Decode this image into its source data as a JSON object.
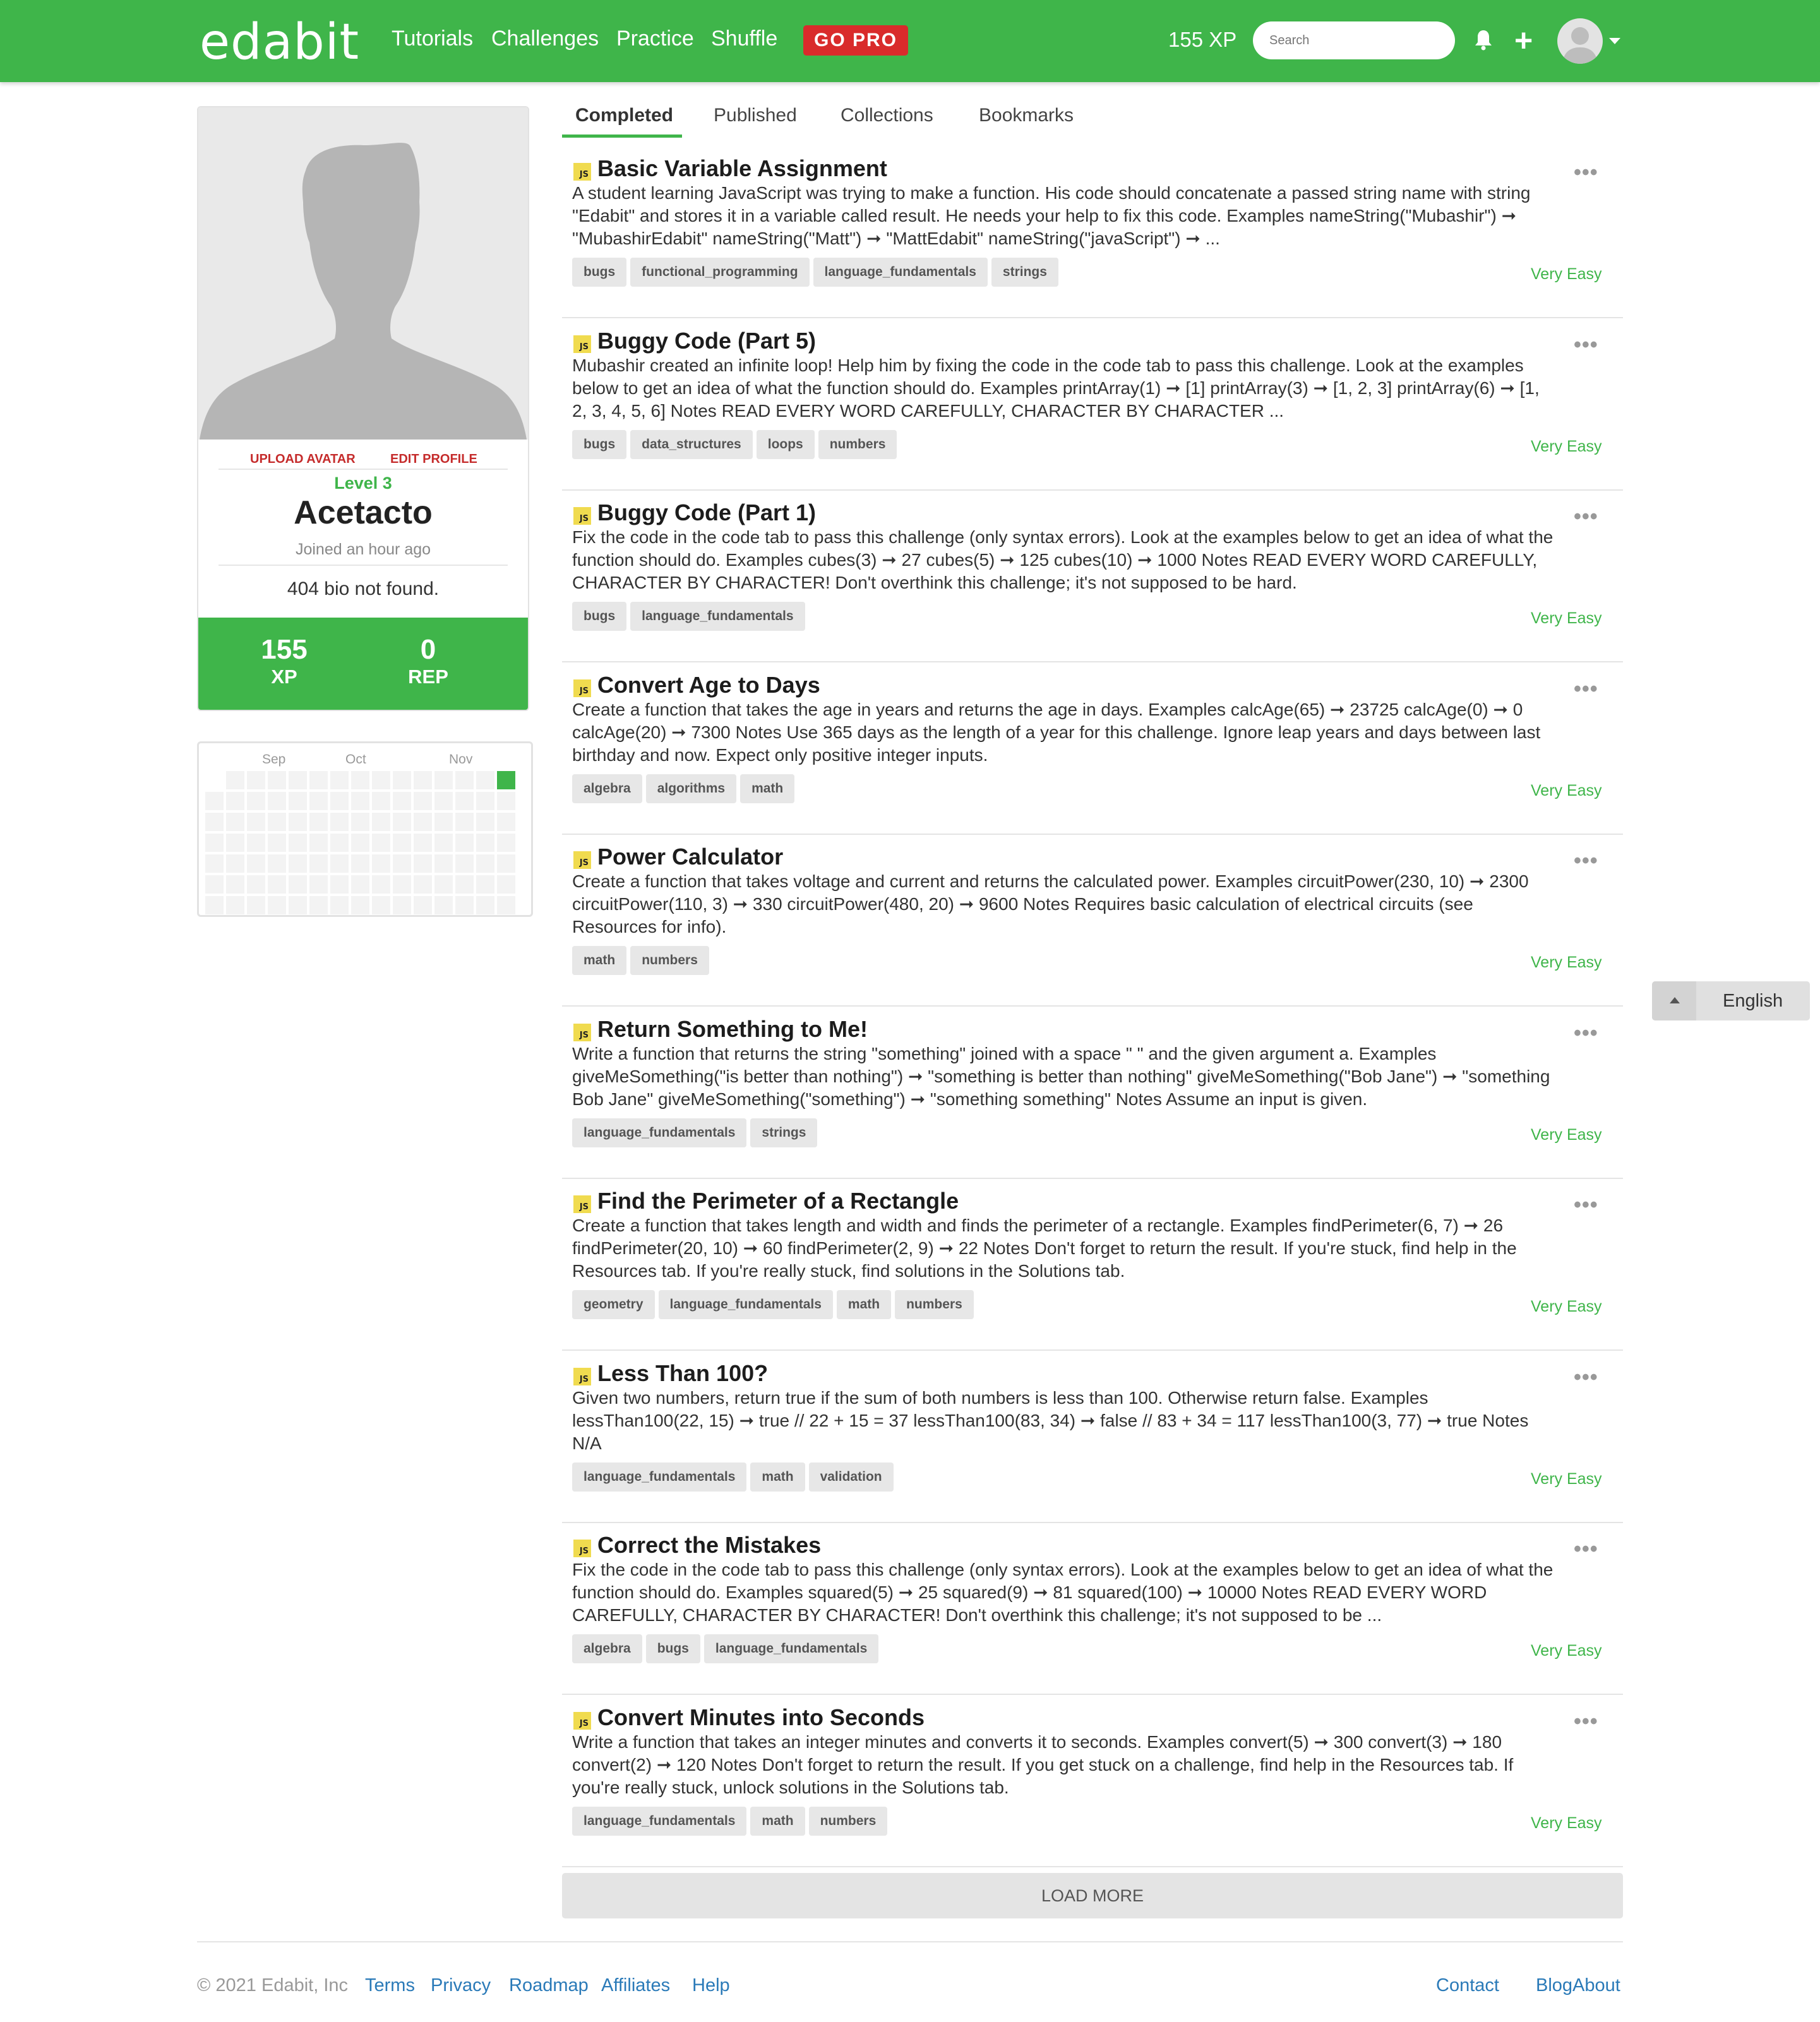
{
  "nav": {
    "logo": "edabit",
    "links": [
      "Tutorials",
      "Challenges",
      "Practice",
      "Shuffle"
    ],
    "go_pro": "GO PRO",
    "xp": "155 XP",
    "search_placeholder": "Search"
  },
  "profile": {
    "upload_avatar": "UPLOAD AVATAR",
    "edit_profile": "EDIT PROFILE",
    "level": "Level 3",
    "username": "Acetacto",
    "joined": "Joined an hour ago",
    "bio": "404 bio not found.",
    "xp_value": "155",
    "xp_label": "XP",
    "rep_value": "0",
    "rep_label": "REP"
  },
  "calendar": {
    "months": [
      "Sep",
      "Oct",
      "Nov"
    ],
    "active_color": "#3fb54a"
  },
  "tabs": [
    "Completed",
    "Published",
    "Collections",
    "Bookmarks"
  ],
  "challenges": [
    {
      "badge": "JS",
      "title": "Basic Variable Assignment",
      "description": "A student learning JavaScript was trying to make a function. His code should concatenate a passed string name with string \"Edabit\" and stores it in a variable called result. He needs your help to fix this code. Examples nameString(\"Mubashir\") ➞ \"MubashirEdabit\" nameString(\"Matt\") ➞ \"MattEdabit\" nameString(\"javaScript\") ➞ ...",
      "tags": [
        "bugs",
        "functional_programming",
        "language_fundamentals",
        "strings"
      ],
      "difficulty": "Very Easy"
    },
    {
      "badge": "JS",
      "title": "Buggy Code (Part 5)",
      "description": "Mubashir created an infinite loop! Help him by fixing the code in the code tab to pass this challenge. Look at the examples below to get an idea of what the function should do. Examples printArray(1) ➞ [1] printArray(3) ➞ [1, 2, 3] printArray(6) ➞ [1, 2, 3, 4, 5, 6] Notes READ EVERY WORD CAREFULLY, CHARACTER BY CHARACTER ...",
      "tags": [
        "bugs",
        "data_structures",
        "loops",
        "numbers"
      ],
      "difficulty": "Very Easy"
    },
    {
      "badge": "JS",
      "title": "Buggy Code (Part 1)",
      "description": "Fix the code in the code tab to pass this challenge (only syntax errors). Look at the examples below to get an idea of what the function should do. Examples cubes(3) ➞ 27 cubes(5) ➞ 125 cubes(10) ➞ 1000 Notes READ EVERY WORD CAREFULLY, CHARACTER BY CHARACTER! Don't overthink this challenge; it's not supposed to be hard.",
      "tags": [
        "bugs",
        "language_fundamentals"
      ],
      "difficulty": "Very Easy"
    },
    {
      "badge": "JS",
      "title": "Convert Age to Days",
      "description": "Create a function that takes the age in years and returns the age in days. Examples calcAge(65) ➞ 23725 calcAge(0) ➞ 0 calcAge(20) ➞ 7300 Notes Use 365 days as the length of a year for this challenge. Ignore leap years and days between last birthday and now. Expect only positive integer inputs.",
      "tags": [
        "algebra",
        "algorithms",
        "math"
      ],
      "difficulty": "Very Easy"
    },
    {
      "badge": "JS",
      "title": "Power Calculator",
      "description": "Create a function that takes voltage and current and returns the calculated power. Examples circuitPower(230, 10) ➞ 2300 circuitPower(110, 3) ➞ 330 circuitPower(480, 20) ➞ 9600 Notes Requires basic calculation of electrical circuits (see Resources for info).",
      "tags": [
        "math",
        "numbers"
      ],
      "difficulty": "Very Easy"
    },
    {
      "badge": "JS",
      "title": "Return Something to Me!",
      "description": "Write a function that returns the string \"something\" joined with a space \" \" and the given argument a. Examples giveMeSomething(\"is better than nothing\") ➞ \"something is better than nothing\" giveMeSomething(\"Bob Jane\") ➞ \"something Bob Jane\" giveMeSomething(\"something\") ➞ \"something something\" Notes Assume an input is given.",
      "tags": [
        "language_fundamentals",
        "strings"
      ],
      "difficulty": "Very Easy"
    },
    {
      "badge": "JS",
      "title": "Find the Perimeter of a Rectangle",
      "description": "Create a function that takes length and width and finds the perimeter of a rectangle. Examples findPerimeter(6, 7) ➞ 26 findPerimeter(20, 10) ➞ 60 findPerimeter(2, 9) ➞ 22 Notes Don't forget to return the result. If you're stuck, find help in the Resources tab. If you're really stuck, find solutions in the Solutions tab.",
      "tags": [
        "geometry",
        "language_fundamentals",
        "math",
        "numbers"
      ],
      "difficulty": "Very Easy"
    },
    {
      "badge": "JS",
      "title": "Less Than 100?",
      "description": "Given two numbers, return true if the sum of both numbers is less than 100. Otherwise return false. Examples lessThan100(22, 15) ➞ true // 22 + 15 = 37 lessThan100(83, 34) ➞ false // 83 + 34 = 117 lessThan100(3, 77) ➞ true Notes N/A",
      "tags": [
        "language_fundamentals",
        "math",
        "validation"
      ],
      "difficulty": "Very Easy"
    },
    {
      "badge": "JS",
      "title": "Correct the Mistakes",
      "description": "Fix the code in the code tab to pass this challenge (only syntax errors). Look at the examples below to get an idea of what the function should do. Examples squared(5) ➞ 25 squared(9) ➞ 81 squared(100) ➞ 10000 Notes READ EVERY WORD CAREFULLY, CHARACTER BY CHARACTER! Don't overthink this challenge; it's not supposed to be ...",
      "tags": [
        "algebra",
        "bugs",
        "language_fundamentals"
      ],
      "difficulty": "Very Easy"
    },
    {
      "badge": "JS",
      "title": "Convert Minutes into Seconds",
      "description": "Write a function that takes an integer minutes and converts it to seconds. Examples convert(5) ➞ 300 convert(3) ➞ 180 convert(2) ➞ 120 Notes Don't forget to return the result. If you get stuck on a challenge, find help in the Resources tab. If you're really stuck, unlock solutions in the Solutions tab.",
      "tags": [
        "language_fundamentals",
        "math",
        "numbers"
      ],
      "difficulty": "Very Easy"
    }
  ],
  "load_more": "LOAD MORE",
  "language": "English",
  "footer": {
    "copyright": "© 2021 Edabit, Inc",
    "left_links": [
      "Terms",
      "Privacy",
      "Roadmap",
      "Affiliates",
      "Help"
    ],
    "right_links": [
      "Contact",
      "Blog",
      "About"
    ]
  },
  "colors": {
    "brand_green": "#3fb54a",
    "go_pro_red": "#d92b2b",
    "link_blue": "#2a7ab8",
    "js_yellow": "#f0db4f"
  }
}
